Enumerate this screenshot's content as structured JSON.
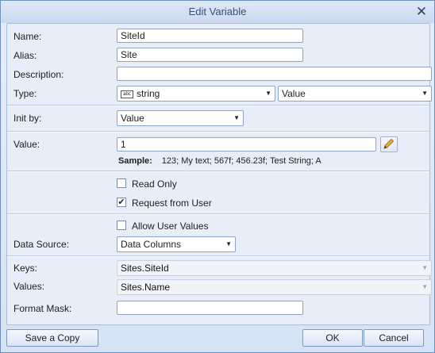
{
  "window": {
    "title": "Edit Variable",
    "close_glyph": "✕"
  },
  "labels": {
    "name": "Name:",
    "alias": "Alias:",
    "description": "Description:",
    "type": "Type:",
    "init_by": "Init by:",
    "value": "Value:",
    "data_source": "Data Source:",
    "keys": "Keys:",
    "values": "Values:",
    "format_mask": "Format Mask:"
  },
  "fields": {
    "name": "SiteId",
    "alias": "Site",
    "description": "",
    "type": "string",
    "type_icon_text": "abc",
    "type_kind": "Value",
    "init_by": "Value",
    "value": "1",
    "data_source": "Data Columns",
    "keys": "Sites.SiteId",
    "values": "Sites.Name",
    "format_mask": ""
  },
  "sample": {
    "label": "Sample:",
    "text": "123; My text; 567f; 456.23f; Test String; A"
  },
  "checkboxes": {
    "read_only": {
      "label": "Read Only",
      "checked": false
    },
    "request_from_user": {
      "label": "Request from User",
      "checked": true
    },
    "allow_user_values": {
      "label": "Allow User Values",
      "checked": false
    }
  },
  "buttons": {
    "save_copy": "Save a Copy",
    "ok": "OK",
    "cancel": "Cancel"
  },
  "glyphs": {
    "dropdown": "▼",
    "check": "✔"
  },
  "icons": {
    "edit": "pencil-icon",
    "type": "abc-type-icon",
    "close": "close-icon"
  }
}
